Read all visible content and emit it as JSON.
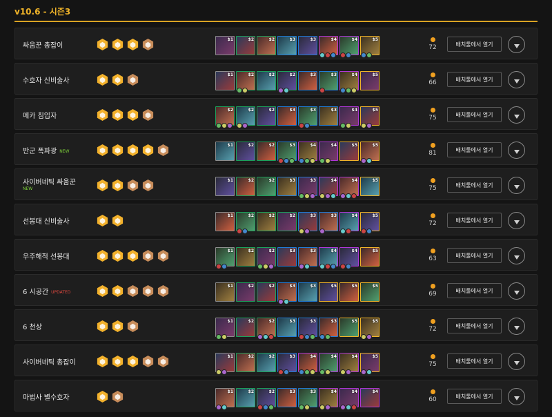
{
  "header": {
    "version": "v10.6 - 시즌3"
  },
  "button_label": "배치툴에서 열기",
  "colors": {
    "accent": "#f0b429",
    "trait_gold": "#f2b12c",
    "trait_silver": "#c8c8c8",
    "trait_bronze": "#c78c5a",
    "cost1": "#8d8d8d",
    "cost2": "#1aa15b",
    "cost3": "#1f7bd6",
    "cost4": "#b037d8",
    "cost5": "#f0b429",
    "new": "#7fd43a",
    "updated": "#e0483f"
  },
  "comps": [
    {
      "name": "싸움꾼 총잡이",
      "badge": "",
      "score": "72",
      "traits": [
        "gold",
        "gold",
        "gold",
        "bronze"
      ],
      "champs": [
        [
          1,
          "$1",
          0
        ],
        [
          2,
          "$2",
          0
        ],
        [
          2,
          "$2",
          0
        ],
        [
          3,
          "$3",
          0
        ],
        [
          3,
          "$3",
          0
        ],
        [
          4,
          "$4",
          3
        ],
        [
          4,
          "$4",
          2
        ],
        [
          5,
          "$5",
          2
        ]
      ]
    },
    {
      "name": "수호자 신비술사",
      "badge": "",
      "score": "66",
      "traits": [
        "gold",
        "gold",
        "bronze"
      ],
      "champs": [
        [
          1,
          "$1",
          0
        ],
        [
          2,
          "$2",
          2
        ],
        [
          2,
          "$2",
          0
        ],
        [
          2,
          "$2",
          2
        ],
        [
          3,
          "$3",
          0
        ],
        [
          3,
          "$3",
          1
        ],
        [
          4,
          "$4",
          3
        ],
        [
          5,
          "$5",
          0
        ]
      ]
    },
    {
      "name": "메카 침입자",
      "badge": "",
      "score": "75",
      "traits": [
        "gold",
        "gold",
        "gold",
        "bronze"
      ],
      "champs": [
        [
          2,
          "$2",
          3
        ],
        [
          2,
          "$2",
          2
        ],
        [
          2,
          "$2",
          0
        ],
        [
          3,
          "$3",
          0
        ],
        [
          3,
          "$3",
          2
        ],
        [
          3,
          "$3",
          0
        ],
        [
          4,
          "$4",
          2
        ],
        [
          5,
          "$5",
          2
        ]
      ]
    },
    {
      "name": "반군 폭파광",
      "badge": "NEW",
      "score": "81",
      "traits": [
        "gold",
        "gold",
        "gold",
        "gold",
        "bronze"
      ],
      "champs": [
        [
          1,
          "$1",
          0
        ],
        [
          2,
          "$2",
          0
        ],
        [
          2,
          "$2",
          0
        ],
        [
          3,
          "$3",
          3
        ],
        [
          4,
          "$4",
          3
        ],
        [
          4,
          "$4",
          2
        ],
        [
          5,
          "$5",
          0
        ],
        [
          5,
          "$5",
          2
        ]
      ]
    },
    {
      "name": "사이버네틱 싸움꾼",
      "badge": "NEW",
      "score": "75",
      "traits": [
        "gold",
        "gold",
        "bronze",
        "bronze"
      ],
      "champs": [
        [
          1,
          "$1",
          0
        ],
        [
          2,
          "$2",
          0
        ],
        [
          2,
          "$2",
          0
        ],
        [
          3,
          "$3",
          0
        ],
        [
          3,
          "$3",
          3
        ],
        [
          4,
          "$4",
          3
        ],
        [
          4,
          "$4",
          3
        ],
        [
          5,
          "$5",
          0
        ]
      ]
    },
    {
      "name": "선봉대 신비술사",
      "badge": "",
      "score": "72",
      "traits": [
        "gold",
        "gold"
      ],
      "champs": [
        [
          1,
          "$1",
          0
        ],
        [
          2,
          "$2",
          2
        ],
        [
          2,
          "$2",
          0
        ],
        [
          2,
          "$2",
          0
        ],
        [
          3,
          "$3",
          2
        ],
        [
          3,
          "$3",
          1
        ],
        [
          4,
          "$4",
          2
        ],
        [
          5,
          "$5",
          2
        ]
      ]
    },
    {
      "name": "우주해적 선봉대",
      "badge": "",
      "score": "63",
      "traits": [
        "gold",
        "gold",
        "gold",
        "bronze",
        "bronze"
      ],
      "champs": [
        [
          1,
          "$1",
          2
        ],
        [
          2,
          "$2",
          0
        ],
        [
          2,
          "$2",
          3
        ],
        [
          3,
          "$3",
          0
        ],
        [
          3,
          "$3",
          2
        ],
        [
          4,
          "$4",
          3
        ],
        [
          4,
          "$4",
          2
        ],
        [
          5,
          "$5",
          0
        ]
      ]
    },
    {
      "name": "6 시공간",
      "badge": "UPDATED",
      "score": "69",
      "traits": [
        "gold",
        "gold",
        "bronze",
        "bronze",
        "bronze"
      ],
      "champs": [
        [
          1,
          "$1",
          0
        ],
        [
          2,
          "$2",
          0
        ],
        [
          2,
          "$2",
          0
        ],
        [
          3,
          "$3",
          2
        ],
        [
          3,
          "$3",
          0
        ],
        [
          5,
          "$5",
          0
        ],
        [
          5,
          "$5",
          0
        ],
        [
          5,
          "$5",
          0
        ]
      ]
    },
    {
      "name": "6 천상",
      "badge": "",
      "score": "72",
      "traits": [
        "gold",
        "gold",
        "bronze"
      ],
      "champs": [
        [
          1,
          "$1",
          2
        ],
        [
          2,
          "$2",
          0
        ],
        [
          2,
          "$2",
          3
        ],
        [
          3,
          "$3",
          0
        ],
        [
          3,
          "$3",
          3
        ],
        [
          3,
          "$3",
          2
        ],
        [
          5,
          "$5",
          0
        ],
        [
          5,
          "$5",
          2
        ]
      ]
    },
    {
      "name": "사이버네틱 총잡이",
      "badge": "",
      "score": "75",
      "traits": [
        "gold",
        "gold",
        "gold",
        "bronze",
        "bronze"
      ],
      "champs": [
        [
          1,
          "$1",
          2
        ],
        [
          2,
          "$2",
          0
        ],
        [
          2,
          "$2",
          0
        ],
        [
          3,
          "$3",
          2
        ],
        [
          4,
          "$4",
          3
        ],
        [
          4,
          "$4",
          2
        ],
        [
          4,
          "$4",
          2
        ],
        [
          5,
          "$5",
          2
        ]
      ]
    },
    {
      "name": "마법사 별수호자",
      "badge": "",
      "score": "60",
      "traits": [
        "gold",
        "bronze"
      ],
      "champs": [
        [
          1,
          "$1",
          2
        ],
        [
          2,
          "$2",
          0
        ],
        [
          2,
          "$2",
          3
        ],
        [
          3,
          "$3",
          0
        ],
        [
          3,
          "$3",
          2
        ],
        [
          4,
          "$4",
          2
        ],
        [
          4,
          "$4",
          3
        ],
        [
          4,
          "$4",
          0
        ]
      ]
    }
  ]
}
